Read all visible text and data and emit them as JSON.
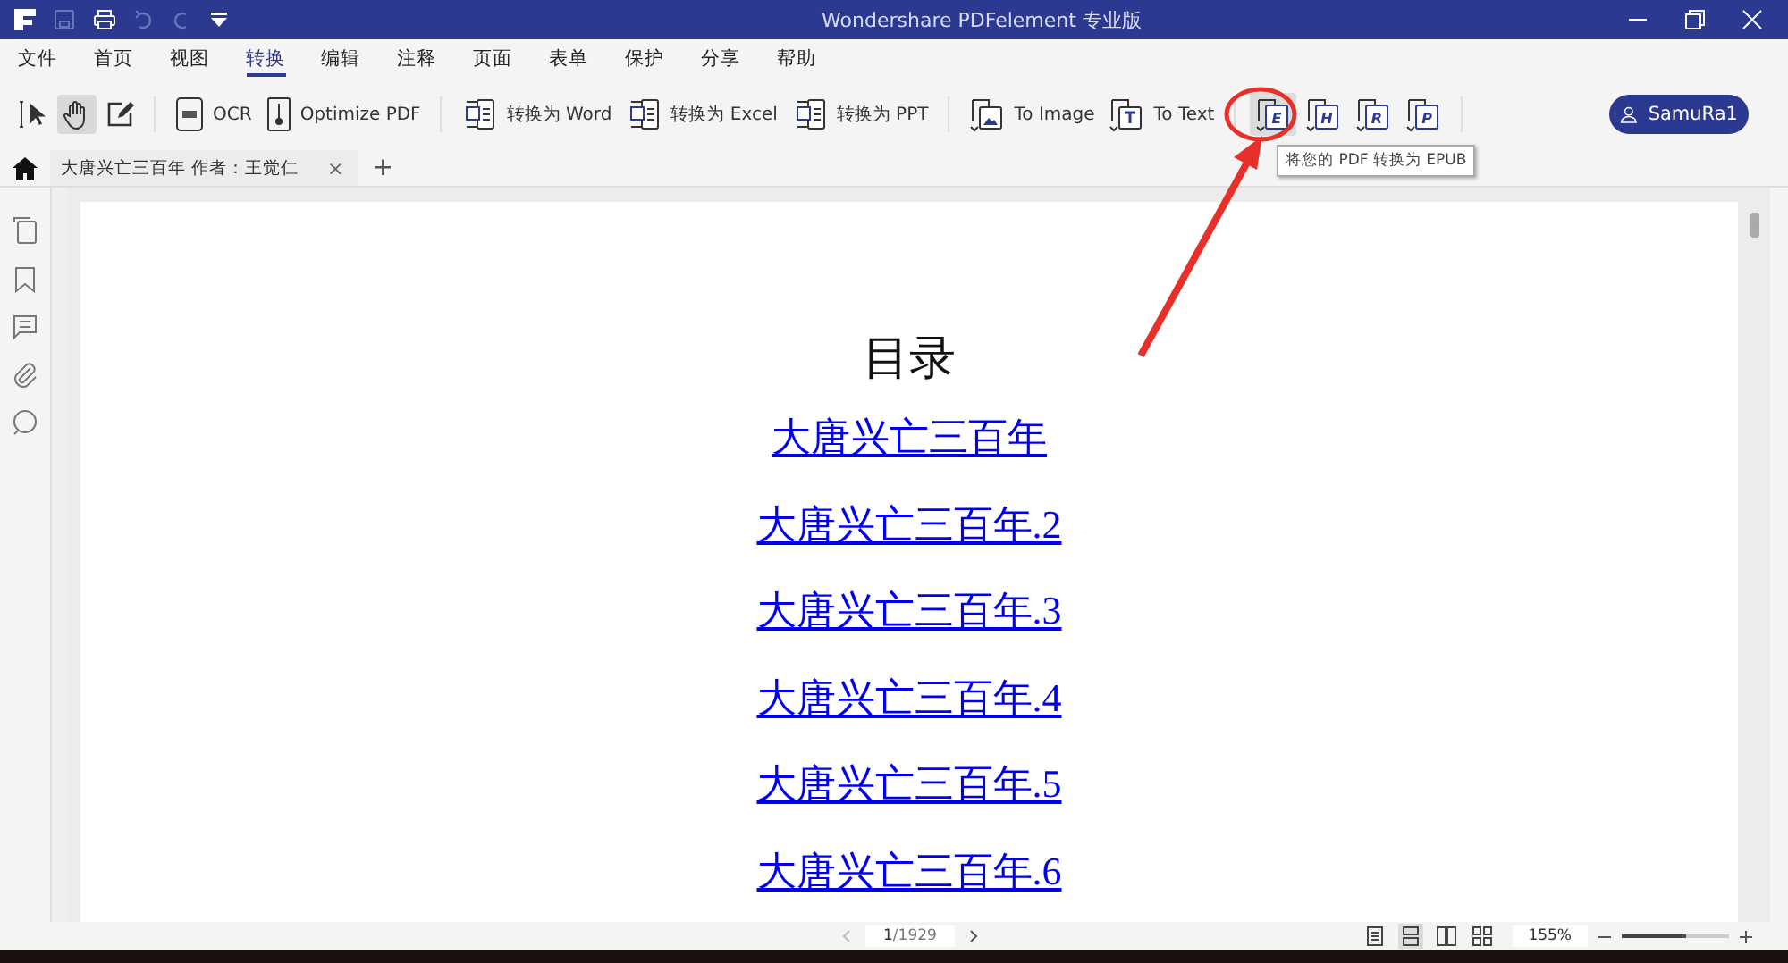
{
  "window": {
    "title": "Wondershare PDFelement 专业版"
  },
  "menu": [
    {
      "label": "文件",
      "selected": false
    },
    {
      "label": "首页",
      "selected": false
    },
    {
      "label": "视图",
      "selected": false
    },
    {
      "label": "转换",
      "selected": true
    },
    {
      "label": "编辑",
      "selected": false
    },
    {
      "label": "注释",
      "selected": false
    },
    {
      "label": "页面",
      "selected": false
    },
    {
      "label": "表单",
      "selected": false
    },
    {
      "label": "保护",
      "selected": false
    },
    {
      "label": "分享",
      "selected": false
    },
    {
      "label": "帮助",
      "selected": false
    }
  ],
  "tools": [
    {
      "kind": "select",
      "selected": false
    },
    {
      "kind": "hand",
      "selected": true
    },
    {
      "kind": "edit",
      "selected": false
    }
  ],
  "toolbar_groups": [
    [
      {
        "kind": "ocr",
        "label": "OCR"
      },
      {
        "kind": "optimize",
        "label": "Optimize PDF"
      }
    ],
    [
      {
        "kind": "word",
        "label": "转换为 Word"
      },
      {
        "kind": "excel",
        "label": "转换为 Excel"
      },
      {
        "kind": "ppt",
        "label": "转换为 PPT"
      }
    ],
    [
      {
        "kind": "image",
        "label": "To Image"
      },
      {
        "kind": "text",
        "label": "To Text"
      }
    ]
  ],
  "format_buttons": [
    {
      "letter": "E",
      "hovered": true
    },
    {
      "letter": "H",
      "hovered": false
    },
    {
      "letter": "R",
      "hovered": false
    },
    {
      "letter": "P",
      "hovered": false
    }
  ],
  "tooltip": "将您的 PDF 转换为 EPUB",
  "user": "SamuRa1",
  "document_tab": {
    "title": "大唐兴亡三百年 作者：王觉仁",
    "close": "×",
    "add": "+"
  },
  "document": {
    "heading": "目录",
    "links": [
      "大唐兴亡三百年",
      "大唐兴亡三百年.2",
      "大唐兴亡三百年.3",
      "大唐兴亡三百年.4",
      "大唐兴亡三百年.5",
      "大唐兴亡三百年.6"
    ]
  },
  "status_bar": {
    "page": "1",
    "total": "/1929",
    "view_modes": [
      {
        "kind": "single",
        "selected": false
      },
      {
        "kind": "continuous",
        "selected": true
      },
      {
        "kind": "double",
        "selected": false
      },
      {
        "kind": "grid",
        "selected": false
      }
    ],
    "zoom": "155%",
    "zoom_slider": {
      "level": 0.6
    }
  }
}
